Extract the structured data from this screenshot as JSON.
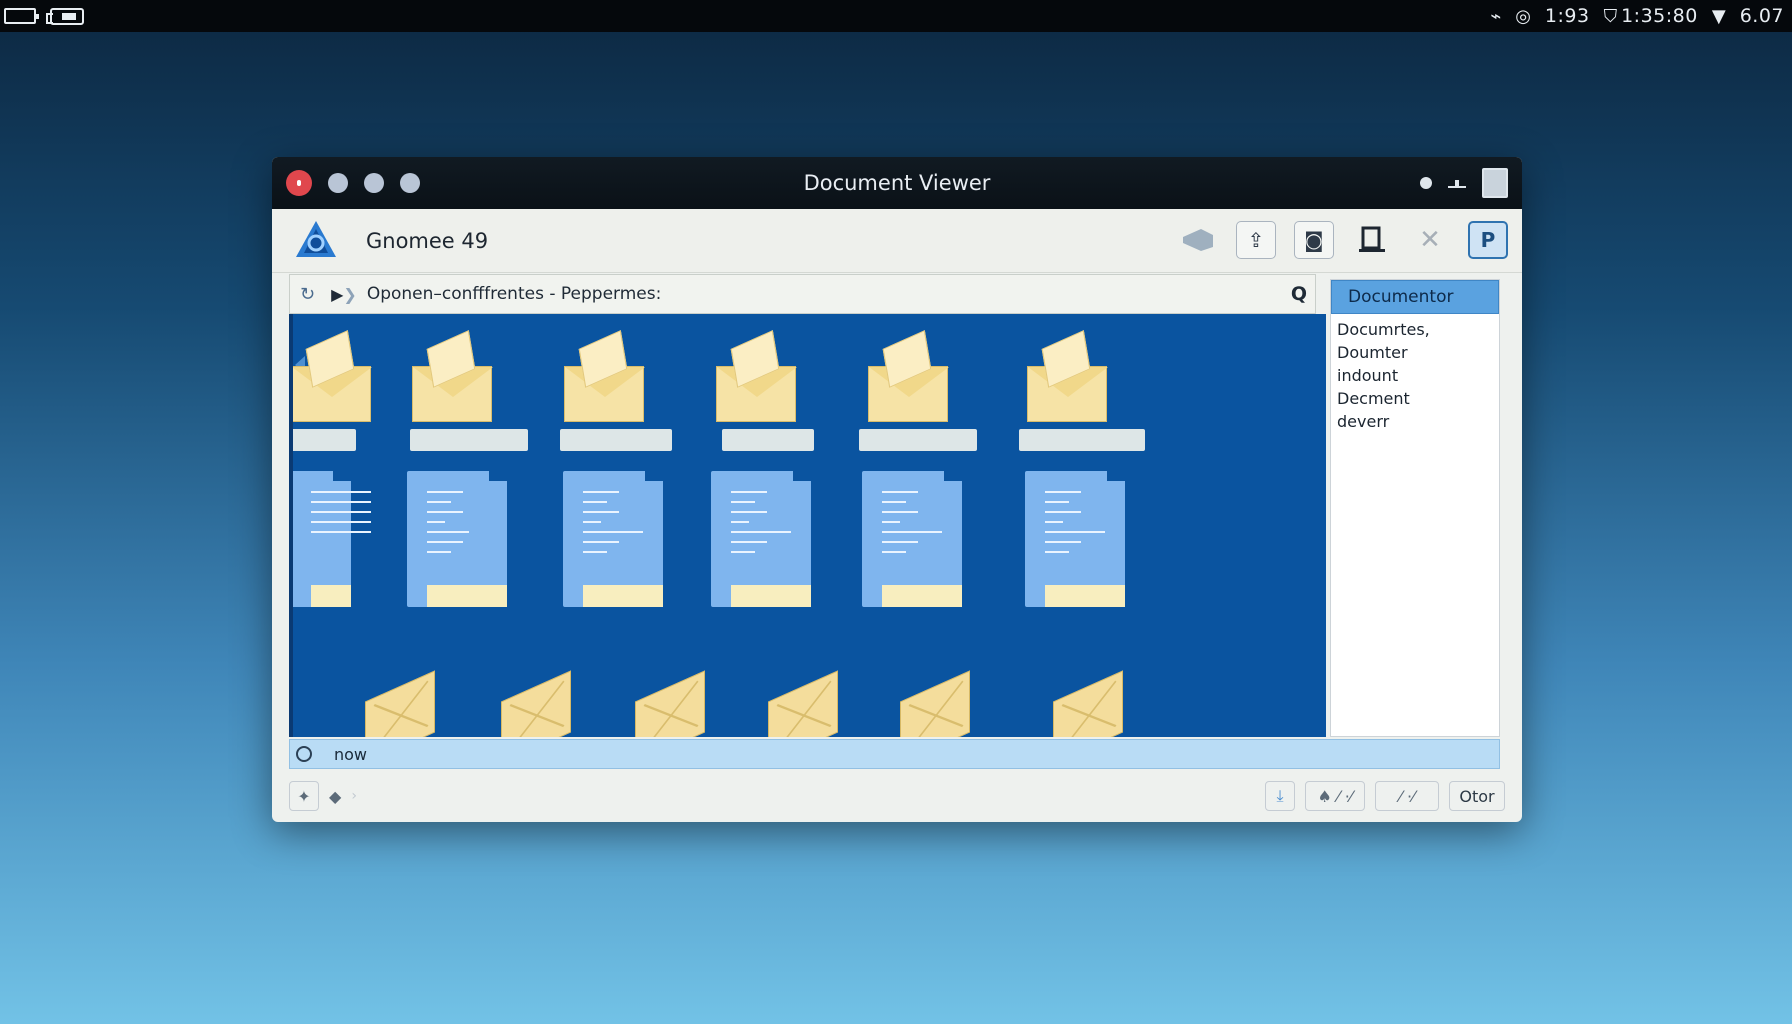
{
  "top_bar": {
    "tray_value_1": "1:93",
    "tray_clock": "1:35:80",
    "tray_value_2": "6.07",
    "icons": [
      "battery-icon",
      "display-icon",
      "tag-icon",
      "settings-icon",
      "shield-icon",
      "wifi-icon"
    ]
  },
  "window": {
    "title": "Document Viewer"
  },
  "header": {
    "app_name": "Gnomee 49",
    "tools": [
      "megaphone-icon",
      "upload-icon",
      "camera-icon",
      "monitor-icon",
      "close-x-icon",
      "p-icon"
    ],
    "active_tool_label": "P"
  },
  "pathbar": {
    "path": "Oponen–confffrentes  -  Peppermes:",
    "search_glyph": "Q"
  },
  "side_panel": {
    "header": "Documentor",
    "items": [
      "Documrtes,",
      "Doumter",
      "indount",
      "Decment",
      "deverr"
    ]
  },
  "status": {
    "text": "now"
  },
  "bottom": {
    "right_button": "Otor",
    "button_2": "⁄ ·⁄",
    "button_3": "⁄ ·⁄"
  },
  "colors": {
    "content_bg": "#0a54a0",
    "accent": "#5aa2e0",
    "close_dot": "#e0474d"
  }
}
